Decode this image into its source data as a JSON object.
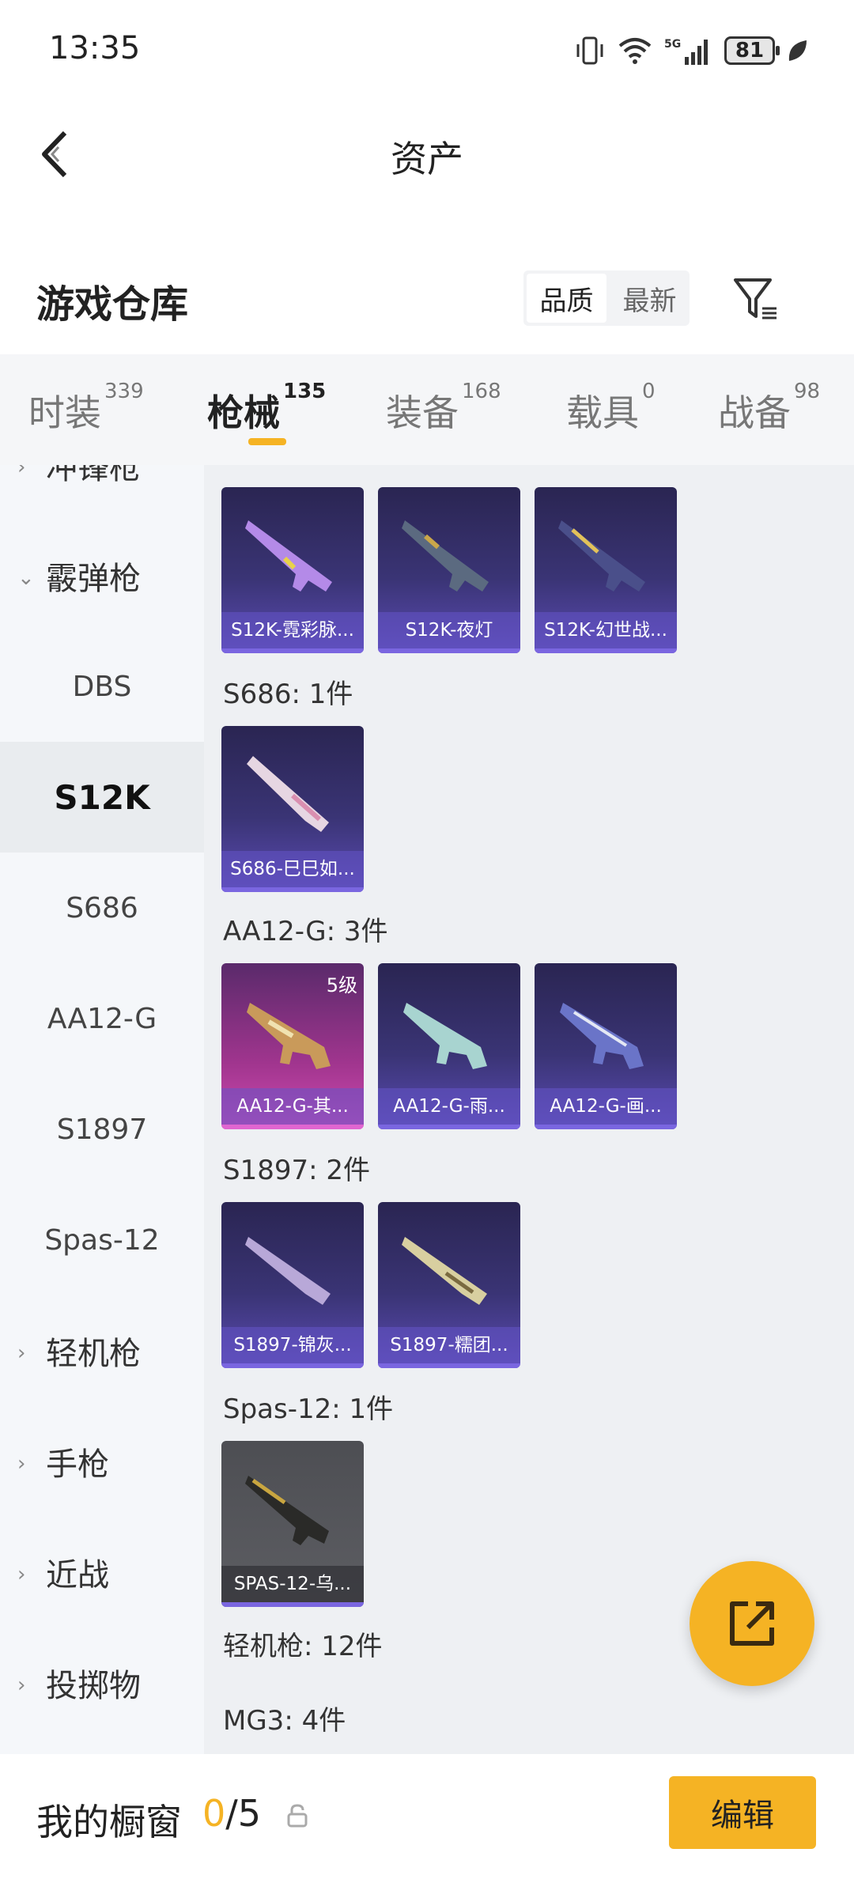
{
  "status_bar": {
    "time": "13:35",
    "battery": "81"
  },
  "header": {
    "title": "资产"
  },
  "warehouse": {
    "title": "游戏仓库",
    "sort": [
      "品质",
      "最新"
    ]
  },
  "tabs": [
    {
      "label": "时装",
      "count": "339"
    },
    {
      "label": "枪械",
      "count": "135"
    },
    {
      "label": "装备",
      "count": "168"
    },
    {
      "label": "载具",
      "count": "0"
    },
    {
      "label": "战备",
      "count": "98"
    }
  ],
  "sidebar": {
    "items": [
      {
        "label": "冲锋枪"
      },
      {
        "label": "霰弹枪"
      },
      {
        "label": "DBS"
      },
      {
        "label": "S12K"
      },
      {
        "label": "S686"
      },
      {
        "label": "AA12-G"
      },
      {
        "label": "S1897"
      },
      {
        "label": "Spas-12"
      },
      {
        "label": "轻机枪"
      },
      {
        "label": "手枪"
      },
      {
        "label": "近战"
      },
      {
        "label": "投掷物"
      }
    ]
  },
  "groups": [
    {
      "label": "",
      "cards": [
        {
          "name": "S12K-霓彩脉..."
        },
        {
          "name": "S12K-夜灯"
        },
        {
          "name": "S12K-幻世战..."
        }
      ]
    },
    {
      "label": "S686: 1件",
      "cards": [
        {
          "name": "S686-巳巳如..."
        }
      ]
    },
    {
      "label": "AA12-G: 3件",
      "cards": [
        {
          "name": "AA12-G-其...",
          "level": "5级"
        },
        {
          "name": "AA12-G-雨..."
        },
        {
          "name": "AA12-G-画..."
        }
      ]
    },
    {
      "label": "S1897: 2件",
      "cards": [
        {
          "name": "S1897-锦灰..."
        },
        {
          "name": "S1897-糯团..."
        }
      ]
    },
    {
      "label": "Spas-12: 1件",
      "cards": [
        {
          "name": "SPAS-12-乌..."
        }
      ]
    },
    {
      "label": "轻机枪: 12件",
      "cards": []
    },
    {
      "label": "MG3: 4件",
      "cards": []
    }
  ],
  "footer": {
    "label": "我的橱窗",
    "current": "0",
    "total": "/5",
    "edit": "编辑"
  },
  "colors": {
    "accent": "#f5b324",
    "card_purple": "#3a3475",
    "card_pink": "#a0358e",
    "card_gray": "#5d5e63"
  }
}
